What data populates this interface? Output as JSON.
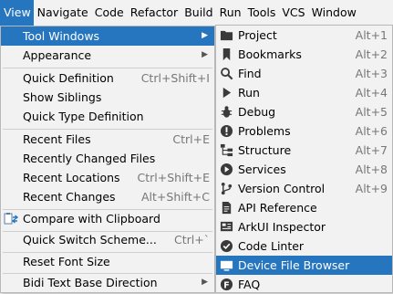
{
  "menubar": {
    "items": [
      {
        "label": "View"
      },
      {
        "label": "Navigate"
      },
      {
        "label": "Code"
      },
      {
        "label": "Refactor"
      },
      {
        "label": "Build"
      },
      {
        "label": "Run"
      },
      {
        "label": "Tools"
      },
      {
        "label": "VCS"
      },
      {
        "label": "Window"
      }
    ]
  },
  "view_menu": {
    "items": [
      {
        "label": "Tool Windows",
        "shortcut": ""
      },
      {
        "label": "Appearance",
        "shortcut": ""
      },
      {
        "label": "Quick Definition",
        "shortcut": "Ctrl+Shift+I"
      },
      {
        "label": "Show Siblings",
        "shortcut": ""
      },
      {
        "label": "Quick Type Definition",
        "shortcut": ""
      },
      {
        "label": "Recent Files",
        "shortcut": "Ctrl+E"
      },
      {
        "label": "Recently Changed Files",
        "shortcut": ""
      },
      {
        "label": "Recent Locations",
        "shortcut": "Ctrl+Shift+E"
      },
      {
        "label": "Recent Changes",
        "shortcut": "Alt+Shift+C"
      },
      {
        "label": "Compare with Clipboard",
        "shortcut": ""
      },
      {
        "label": "Quick Switch Scheme...",
        "shortcut": "Ctrl+`"
      },
      {
        "label": "Reset Font Size",
        "shortcut": ""
      },
      {
        "label": "Bidi Text Base Direction",
        "shortcut": ""
      }
    ]
  },
  "tool_windows_menu": {
    "items": [
      {
        "label": "Project",
        "shortcut": "Alt+1",
        "icon": "folder-icon"
      },
      {
        "label": "Bookmarks",
        "shortcut": "Alt+2",
        "icon": "bookmark-icon"
      },
      {
        "label": "Find",
        "shortcut": "Alt+3",
        "icon": "search-icon"
      },
      {
        "label": "Run",
        "shortcut": "Alt+4",
        "icon": "run-icon"
      },
      {
        "label": "Debug",
        "shortcut": "Alt+5",
        "icon": "debug-icon"
      },
      {
        "label": "Problems",
        "shortcut": "Alt+6",
        "icon": "problems-icon"
      },
      {
        "label": "Structure",
        "shortcut": "Alt+7",
        "icon": "structure-icon"
      },
      {
        "label": "Services",
        "shortcut": "Alt+8",
        "icon": "services-icon"
      },
      {
        "label": "Version Control",
        "shortcut": "Alt+9",
        "icon": "version-control-icon"
      },
      {
        "label": "API Reference",
        "shortcut": "",
        "icon": "api-reference-icon"
      },
      {
        "label": "ArkUI Inspector",
        "shortcut": "",
        "icon": "inspector-icon"
      },
      {
        "label": "Code Linter",
        "shortcut": "",
        "icon": "code-linter-icon"
      },
      {
        "label": "Device File Browser",
        "shortcut": "",
        "icon": "device-file-browser-icon"
      },
      {
        "label": "FAQ",
        "shortcut": "",
        "icon": "faq-icon"
      }
    ]
  },
  "colors": {
    "selection": "#2675bf",
    "menu_bg": "#f2f2f2"
  }
}
